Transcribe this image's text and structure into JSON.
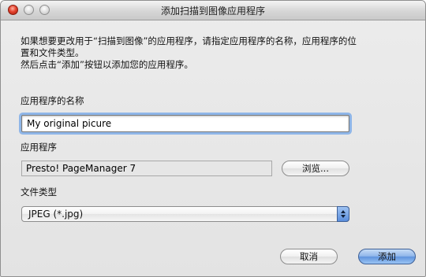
{
  "window": {
    "title": "添加扫描到图像应用程序"
  },
  "instructions": [
    "如果想要更改用于“扫描到图像”的应用程序，请指定应用程序的名称，应用程序的位",
    "置和文件类型。",
    "然后点击“添加”按钮以添加您的应用程序。"
  ],
  "app_name": {
    "label": "应用程序的名称",
    "value": "My original picure"
  },
  "application": {
    "label": "应用程序",
    "value": "Presto! PageManager 7",
    "browse_label": "浏览..."
  },
  "file_type": {
    "label": "文件类型",
    "selected": "JPEG (*.jpg)"
  },
  "buttons": {
    "cancel": "取消",
    "add": "添加"
  },
  "colors": {
    "focus_ring": "#8fb6e8",
    "default_button": "#6e9fe2"
  }
}
